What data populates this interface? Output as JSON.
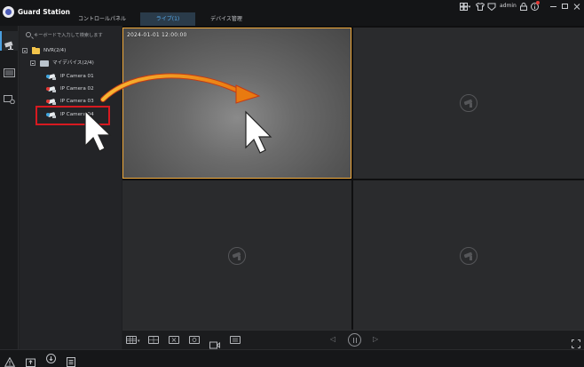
{
  "app": {
    "title": "Guard Station",
    "user": "admin"
  },
  "tabs": [
    {
      "label": "コントロールパネル",
      "active": false
    },
    {
      "label": "ライブ(1)",
      "active": true
    },
    {
      "label": "デバイス管理",
      "active": false
    }
  ],
  "top_icons": [
    "layout-grid-icon",
    "shirt-icon",
    "lock-icon",
    "info-icon",
    "minimize-icon",
    "maximize-icon",
    "close-icon"
  ],
  "rail_icons": [
    "live-view-icon",
    "playback-icon",
    "settings-icon"
  ],
  "search": {
    "placeholder": "キーボードで入力して検索します"
  },
  "tree": {
    "root": {
      "label": "NVR(2/4)"
    },
    "group": {
      "label": "マイデバイス(2/4)"
    },
    "cameras": [
      {
        "label": "IP Camera 01",
        "status": "online",
        "badge_color": "#3fa7e0"
      },
      {
        "label": "IP Camera 02",
        "status": "offline",
        "badge_color": "#e53935"
      },
      {
        "label": "IP Camera 03",
        "status": "offline",
        "badge_color": "#e53935"
      },
      {
        "label": "IP Camera 04",
        "status": "online",
        "badge_color": "#3fa7e0"
      }
    ]
  },
  "grid": {
    "osd_text": "2024-01-01 12:00:00",
    "active_border_color": "#f0a93a"
  },
  "toolbar_icons": [
    "layout-select-icon",
    "split-window-icon",
    "close-all-icon",
    "snapshot-icon",
    "record-icon",
    "video-icon"
  ],
  "playback_icons": [
    "prev-icon",
    "pause-icon",
    "next-icon",
    "fullscreen-icon"
  ],
  "status_icons": [
    "alarm-icon",
    "export-icon",
    "download-icon",
    "task-list-icon"
  ],
  "annotation": {
    "highlight_color": "#d71920",
    "arrow_color": "#f3a315"
  }
}
